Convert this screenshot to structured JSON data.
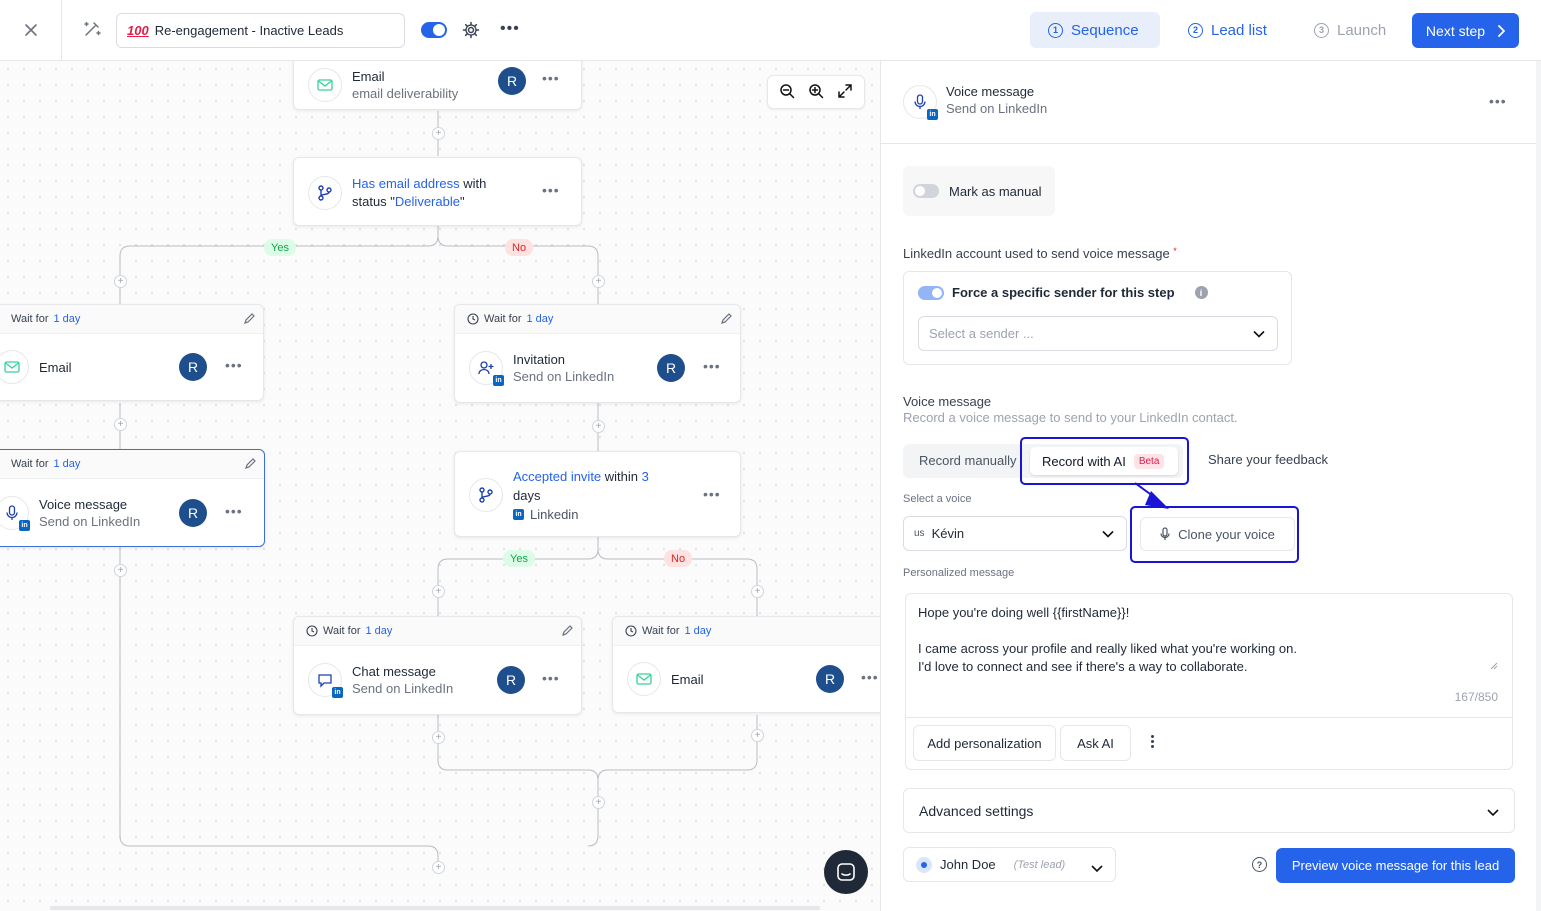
{
  "header": {
    "campaign_emoji": "100",
    "campaign_name": "Re-engagement - Inactive Leads",
    "steps": [
      {
        "num": "1",
        "label": "Sequence"
      },
      {
        "num": "2",
        "label": "Lead list"
      },
      {
        "num": "3",
        "label": "Launch"
      }
    ],
    "next_label": "Next step",
    "accent": "#2563eb"
  },
  "canvas": {
    "top_node": {
      "title": "Email",
      "sub": "email deliverability",
      "avatar": "R"
    },
    "cond1": {
      "pre": "Has email address",
      "mid": " with",
      "line2a": "status \"",
      "line2b": "Deliverable",
      "line2c": "\""
    },
    "yes": "Yes",
    "no": "No",
    "wait_prefix": "Wait for",
    "wait_value": "1 day",
    "left_email": {
      "title": "Email",
      "avatar": "R"
    },
    "invitation": {
      "title": "Invitation",
      "sub": "Send on LinkedIn",
      "avatar": "R"
    },
    "voice": {
      "title": "Voice message",
      "sub": "Send on LinkedIn",
      "avatar": "R"
    },
    "cond2": {
      "pre": "Accepted invite",
      "mid": " within ",
      "num": "3",
      "line2": "days",
      "li": "Linkedin"
    },
    "chat": {
      "title": "Chat message",
      "sub": "Send on LinkedIn",
      "avatar": "R"
    },
    "right_email": {
      "title": "Email",
      "avatar": "R"
    }
  },
  "panel": {
    "title": "Voice message",
    "sub": "Send on LinkedIn",
    "mark_manual": "Mark as manual",
    "account_label": "LinkedIn account used to send voice message",
    "required": "*",
    "force_label": "Force a specific sender for this step",
    "sender_placeholder": "Select a sender ...",
    "voice_heading": "Voice message",
    "voice_desc": "Record a voice message to send to your LinkedIn contact.",
    "tab_manual": "Record manually",
    "tab_ai": "Record with AI",
    "beta": "Beta",
    "feedback": "Share your feedback",
    "select_voice_label": "Select a voice",
    "voice_flag": "us",
    "voice_name": "Kévin",
    "clone": "Clone your voice",
    "personalized_label": "Personalized message",
    "message": "Hope you're doing well {{firstName}}!\n\nI came across your profile and really liked what you're working on.\nI'd love to connect and see if there's a way to collaborate.",
    "counter": "167/850",
    "add_personalization": "Add personalization",
    "ask_ai": "Ask AI",
    "advanced": "Advanced settings",
    "lead_name": "John Doe",
    "test_lead": "(Test lead)",
    "preview": "Preview voice message for this lead"
  }
}
